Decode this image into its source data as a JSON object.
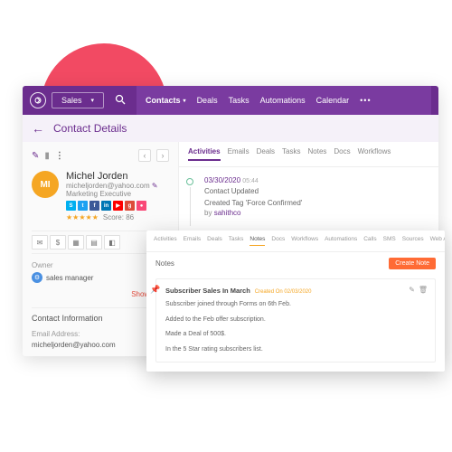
{
  "topnav": {
    "module": "Sales",
    "items": [
      "Contacts",
      "Deals",
      "Tasks",
      "Automations",
      "Calendar"
    ],
    "active": 0
  },
  "subheader": {
    "title": "Contact Details"
  },
  "contact": {
    "initials": "MI",
    "name": "Michel Jorden",
    "email": "micheljorden@yahoo.com",
    "role": "Marketing Executive",
    "score_label": "Score:",
    "score": "86",
    "stars": "★★★★★"
  },
  "owner": {
    "label": "Owner",
    "name": "sales manager"
  },
  "show_gadgets": "Show Gadg",
  "contact_info": {
    "head": "Contact Information",
    "email_label": "Email Address:",
    "email_value": "micheljorden@yahoo.com"
  },
  "detail_tabs": [
    "Activities",
    "Emails",
    "Deals",
    "Tasks",
    "Notes",
    "Docs",
    "Workflows"
  ],
  "detail_active": 0,
  "timeline": {
    "date": "03/30/2020",
    "time": "05:44",
    "line1": "Contact Updated",
    "line2": "Created Tag 'Force Confirmed'",
    "by_label": "by",
    "by": "sahithco"
  },
  "notes": {
    "tabs": [
      "Activities",
      "Emails",
      "Deals",
      "Tasks",
      "Notes",
      "Docs",
      "Workflows",
      "Automations",
      "Calls",
      "SMS",
      "Sources",
      "Web Analy"
    ],
    "active": 4,
    "section_title": "Notes",
    "create_btn": "Create Note",
    "entry": {
      "title": "Subscriber Sales In March",
      "meta": "Created On 02/03/2020",
      "l1": "Subscriber joined through Forms on 6th Feb.",
      "l2": "Added to the Feb offer subscription.",
      "l3": "Made a Deal of 500$.",
      "l4": "In the 5 Star rating subscribers list."
    }
  },
  "social_colors": {
    "sk": "#00aff0",
    "tw": "#1da1f2",
    "fb": "#3b5998",
    "li": "#0077b5",
    "yt": "#ff0000",
    "gp": "#dd4b39",
    "fs": "#f94877"
  }
}
